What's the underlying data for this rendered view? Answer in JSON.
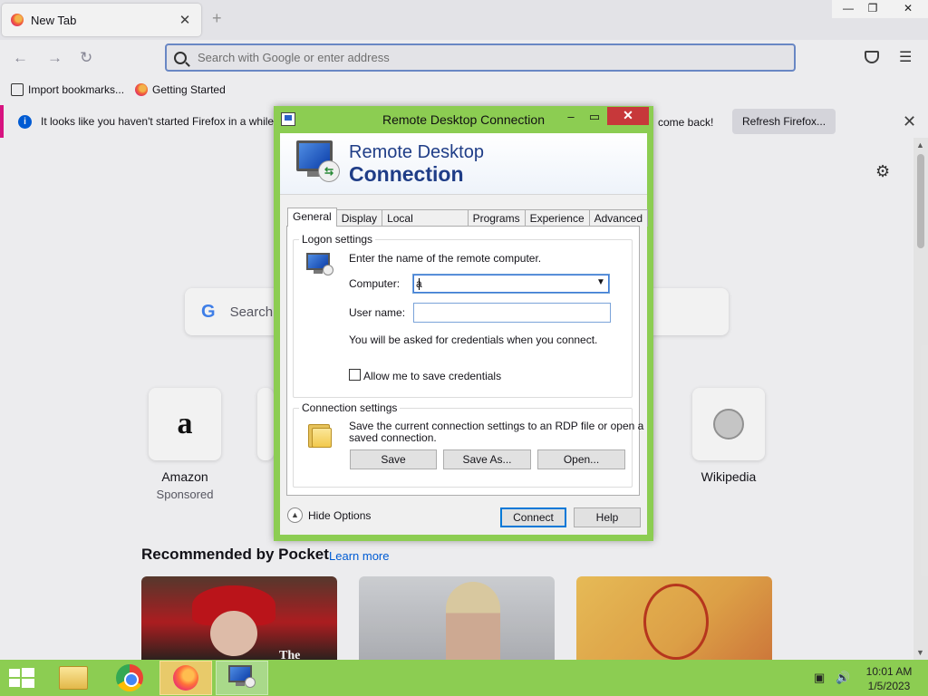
{
  "firefox": {
    "tab_title": "New Tab",
    "tab_close": "✕",
    "new_tab": "+",
    "window_buttons": {
      "minimize": "—",
      "restore": "❐",
      "close": "✕"
    },
    "nav": {
      "back": "←",
      "forward": "→",
      "reload": "↻",
      "menu": "☰"
    },
    "urlbar_placeholder": "Search with Google or enter address",
    "bookmarks": [
      {
        "label": "Import bookmarks..."
      },
      {
        "label": "Getting Started"
      }
    ],
    "notification": {
      "text": "It looks like you haven't started Firefox in a while.",
      "text_tail": "come back!",
      "button": "Refresh Firefox...",
      "close": "✕"
    },
    "newtab": {
      "settings_icon": "⚙",
      "search_logo": "G",
      "search_placeholder": "Search",
      "shortcuts": [
        {
          "glyph": "a",
          "label": "Amazon",
          "sub": "Sponsored"
        },
        {
          "label": "Wikipedia"
        }
      ],
      "pocket_heading": "Recommended by Pocket",
      "pocket_link": "Learn more",
      "card1_text": "The"
    }
  },
  "rdp": {
    "window_title": "Remote Desktop Connection",
    "title_buttons": {
      "minimize": "–",
      "maximize": "▭",
      "close": "✕"
    },
    "banner_line1": "Remote Desktop",
    "banner_line2": "Connection",
    "tabs": [
      "General",
      "Display",
      "Local Resources",
      "Programs",
      "Experience",
      "Advanced"
    ],
    "active_tab": "General",
    "logon": {
      "legend": "Logon settings",
      "instruction": "Enter the name of the remote computer.",
      "computer_label": "Computer:",
      "computer_value": "a",
      "username_label": "User name:",
      "username_value": "",
      "credentials_note": "You will be asked for credentials when you connect.",
      "save_credentials_label": "Allow me to save credentials",
      "save_credentials_checked": false
    },
    "connection": {
      "legend": "Connection settings",
      "description_line1": "Save the current connection settings to an RDP file or open a",
      "description_line2": "saved connection.",
      "save": "Save",
      "save_as": "Save As...",
      "open": "Open..."
    },
    "hide_options": "Hide Options",
    "connect": "Connect",
    "help": "Help"
  },
  "taskbar": {
    "apps": [
      "start-button",
      "file-explorer",
      "chrome",
      "firefox",
      "remote-desktop"
    ],
    "clock_time": "10:01 AM",
    "clock_date": "1/5/2023"
  },
  "colors": {
    "accent_green": "#8ccd52",
    "rdp_heading": "#1f3d87",
    "notification_stripe": "#e31587",
    "close_red": "#c7383a"
  }
}
